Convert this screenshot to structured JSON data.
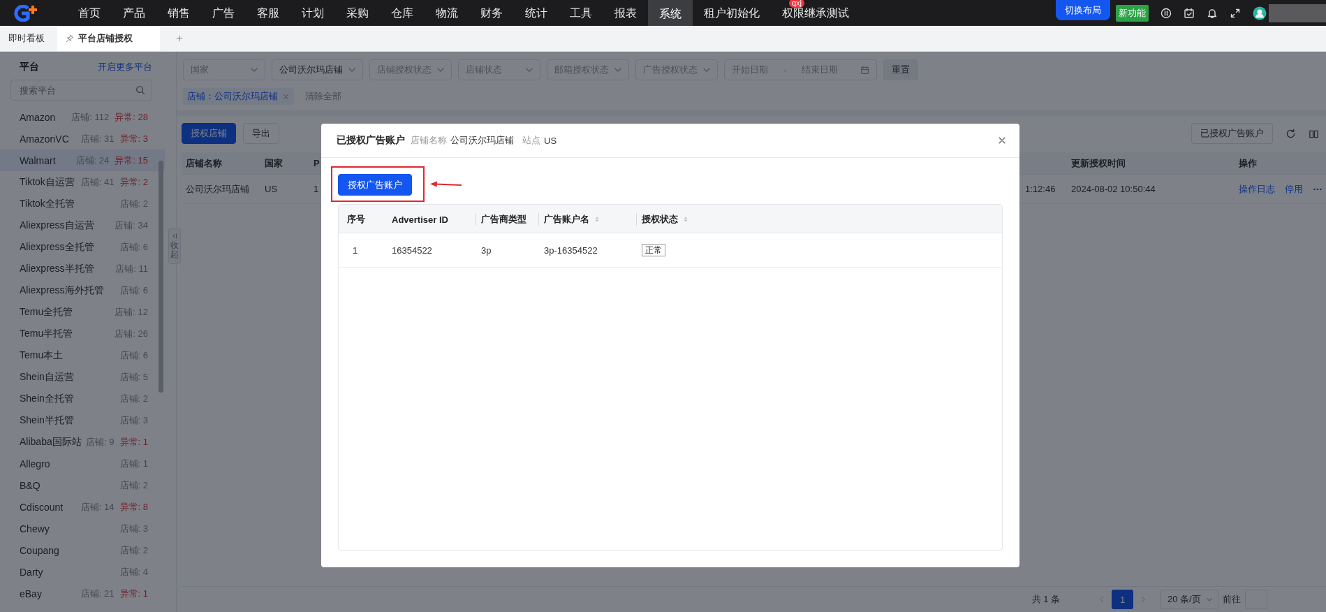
{
  "top_nav": {
    "menu": [
      {
        "label": "首页",
        "selected": false
      },
      {
        "label": "产品",
        "selected": false
      },
      {
        "label": "销售",
        "selected": false
      },
      {
        "label": "广告",
        "selected": false
      },
      {
        "label": "客服",
        "selected": false
      },
      {
        "label": "计划",
        "selected": false
      },
      {
        "label": "采购",
        "selected": false
      },
      {
        "label": "仓库",
        "selected": false
      },
      {
        "label": "物流",
        "selected": false
      },
      {
        "label": "财务",
        "selected": false
      },
      {
        "label": "统计",
        "selected": false
      },
      {
        "label": "工具",
        "selected": false
      },
      {
        "label": "报表",
        "selected": false
      },
      {
        "label": "系统",
        "selected": true
      },
      {
        "label": "租户初始化",
        "selected": false
      },
      {
        "label": "权限继承测试",
        "selected": false,
        "badge": "qxj"
      }
    ],
    "switch_layout": "切换布局",
    "new_feature": "新功能"
  },
  "tabs": [
    {
      "label": "即时看板",
      "selected": false,
      "pinned": false
    },
    {
      "label": "平台店铺授权",
      "selected": true,
      "pinned": true
    }
  ],
  "sidebar": {
    "title": "平台",
    "link": "开启更多平台",
    "search": {
      "placeholder": "搜索平台"
    },
    "collapse": "收起",
    "items": [
      {
        "name": "Amazon",
        "stores": "店铺: 112",
        "abnormal": "异常: 28",
        "selected": false
      },
      {
        "name": "AmazonVC",
        "stores": "店铺: 31",
        "abnormal": "异常: 3",
        "selected": false
      },
      {
        "name": "Walmart",
        "stores": "店铺: 24",
        "abnormal": "异常: 15",
        "selected": true
      },
      {
        "name": "Tiktok自运营",
        "stores": "店铺: 41",
        "abnormal": "异常: 2",
        "selected": false
      },
      {
        "name": "Tiktok全托管",
        "stores": "店铺: 2",
        "selected": false
      },
      {
        "name": "Aliexpress自运营",
        "stores": "店铺: 34",
        "selected": false
      },
      {
        "name": "Aliexpress全托管",
        "stores": "店铺: 6",
        "selected": false
      },
      {
        "name": "Aliexpress半托管",
        "stores": "店铺: 11",
        "selected": false
      },
      {
        "name": "Aliexpress海外托管",
        "stores": "店铺: 6",
        "selected": false
      },
      {
        "name": "Temu全托管",
        "stores": "店铺: 12",
        "selected": false
      },
      {
        "name": "Temu半托管",
        "stores": "店铺: 26",
        "selected": false
      },
      {
        "name": "Temu本土",
        "stores": "店铺: 6",
        "selected": false
      },
      {
        "name": "Shein自运营",
        "stores": "店铺: 5",
        "selected": false
      },
      {
        "name": "Shein全托管",
        "stores": "店铺: 2",
        "selected": false
      },
      {
        "name": "Shein半托管",
        "stores": "店铺: 3",
        "selected": false
      },
      {
        "name": "Alibaba国际站",
        "stores": "店铺: 9",
        "abnormal": "异常: 1",
        "selected": false
      },
      {
        "name": "Allegro",
        "stores": "店铺: 1",
        "selected": false
      },
      {
        "name": "B&Q",
        "stores": "店铺: 2",
        "selected": false
      },
      {
        "name": "Cdiscount",
        "stores": "店铺: 14",
        "abnormal": "异常: 8",
        "selected": false
      },
      {
        "name": "Chewy",
        "stores": "店铺: 3",
        "selected": false
      },
      {
        "name": "Coupang",
        "stores": "店铺: 2",
        "selected": false
      },
      {
        "name": "Darty",
        "stores": "店铺: 4",
        "selected": false
      },
      {
        "name": "eBay",
        "stores": "店铺: 21",
        "abnormal": "异常: 1",
        "selected": false
      }
    ]
  },
  "filters": {
    "fields": [
      {
        "kind": "select",
        "placeholder": "国家"
      },
      {
        "kind": "select",
        "value": "公司沃尔玛店铺"
      },
      {
        "kind": "select",
        "placeholder": "店铺授权状态"
      },
      {
        "kind": "select",
        "placeholder": "店铺状态"
      },
      {
        "kind": "select",
        "placeholder": "邮箱授权状态"
      },
      {
        "kind": "select",
        "placeholder": "广告授权状态"
      },
      {
        "kind": "date_range",
        "start_placeholder": "开始日期",
        "separator": "-",
        "end_placeholder": "结束日期"
      }
    ],
    "reset": "重置",
    "tags": [
      {
        "label": "店铺：公司沃尔玛店铺"
      }
    ],
    "clear_all": "清除全部"
  },
  "toolbar": {
    "authorize_store": "授权店铺",
    "export": "导出",
    "authorized_ads": "已授权广告账户"
  },
  "table": {
    "columns": [
      {
        "label": "店铺名称"
      },
      {
        "label": "国家"
      },
      {
        "label": "P"
      },
      {},
      {
        "label": "更新授权时间"
      },
      {
        "label": "操作"
      }
    ],
    "rows": [
      {
        "cells": [
          "公司沃尔玛店铺",
          "US",
          "1",
          "1:12:46",
          "2024-08-02 10:50:44"
        ],
        "actions": [
          "操作日志",
          "停用"
        ]
      }
    ]
  },
  "pagination": {
    "total": "共 1 条",
    "pages": [
      {
        "label": "1",
        "selected": true
      }
    ],
    "page_size": "20 条/页",
    "goto": "前往"
  },
  "modal": {
    "title": "已授权广告账户",
    "store_label": "店铺名称",
    "store": "公司沃尔玛店铺",
    "site_label": "站点",
    "site": "US",
    "button": "授权广告账户",
    "table": {
      "columns": [
        {
          "label": "序号",
          "sortable": false
        },
        {
          "label": "Advertiser ID",
          "sortable": false
        },
        {
          "label": "广告商类型",
          "sortable": false
        },
        {
          "label": "广告账户名",
          "sortable": true
        },
        {
          "label": "授权状态",
          "sortable": true
        }
      ],
      "rows": [
        {
          "cells": [
            "1",
            "16354522",
            "3p",
            "3p-16354522"
          ],
          "status": "正常"
        }
      ]
    }
  }
}
